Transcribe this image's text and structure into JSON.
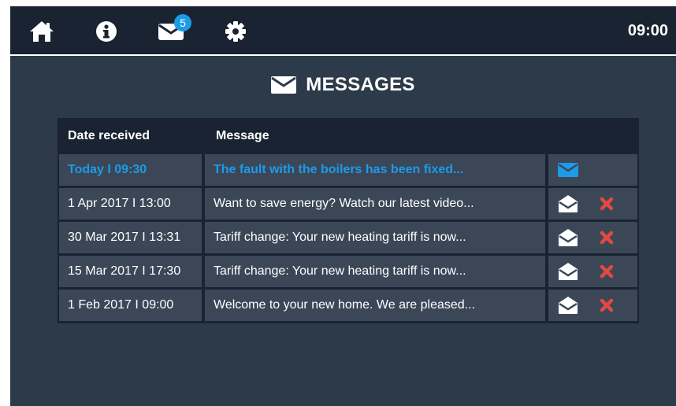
{
  "header": {
    "time": "09:00",
    "nav": [
      {
        "name": "home",
        "icon": "home-icon"
      },
      {
        "name": "info",
        "icon": "info-icon"
      },
      {
        "name": "messages",
        "icon": "envelope-icon",
        "badge": "5"
      },
      {
        "name": "settings",
        "icon": "gear-icon"
      }
    ]
  },
  "page": {
    "title": "MESSAGES",
    "title_icon": "envelope-icon"
  },
  "table": {
    "columns": [
      "Date received",
      "Message"
    ],
    "rows": [
      {
        "date": "Today I 09:30",
        "message": "The fault with the boilers has been fixed...",
        "unread": true,
        "actions": [
          "envelope-closed-icon"
        ]
      },
      {
        "date": "1 Apr 2017 I 13:00",
        "message": "Want to save energy? Watch our latest video...",
        "unread": false,
        "actions": [
          "envelope-open-icon",
          "delete-icon"
        ]
      },
      {
        "date": "30 Mar 2017 I 13:31",
        "message": "Tariff change: Your new heating tariff is now...",
        "unread": false,
        "actions": [
          "envelope-open-icon",
          "delete-icon"
        ]
      },
      {
        "date": "15 Mar 2017 I 17:30",
        "message": "Tariff change: Your new heating tariff is now...",
        "unread": false,
        "actions": [
          "envelope-open-icon",
          "delete-icon"
        ]
      },
      {
        "date": "1 Feb 2017 I 09:00",
        "message": "Welcome to your new home. We are pleased...",
        "unread": false,
        "actions": [
          "envelope-open-icon",
          "delete-icon"
        ]
      }
    ]
  },
  "colors": {
    "background": "#2d3a4a",
    "topbar": "#1a2331",
    "row": "#3b4757",
    "accent": "#1c9be8",
    "delete": "#e04a3f",
    "text": "#ffffff"
  }
}
